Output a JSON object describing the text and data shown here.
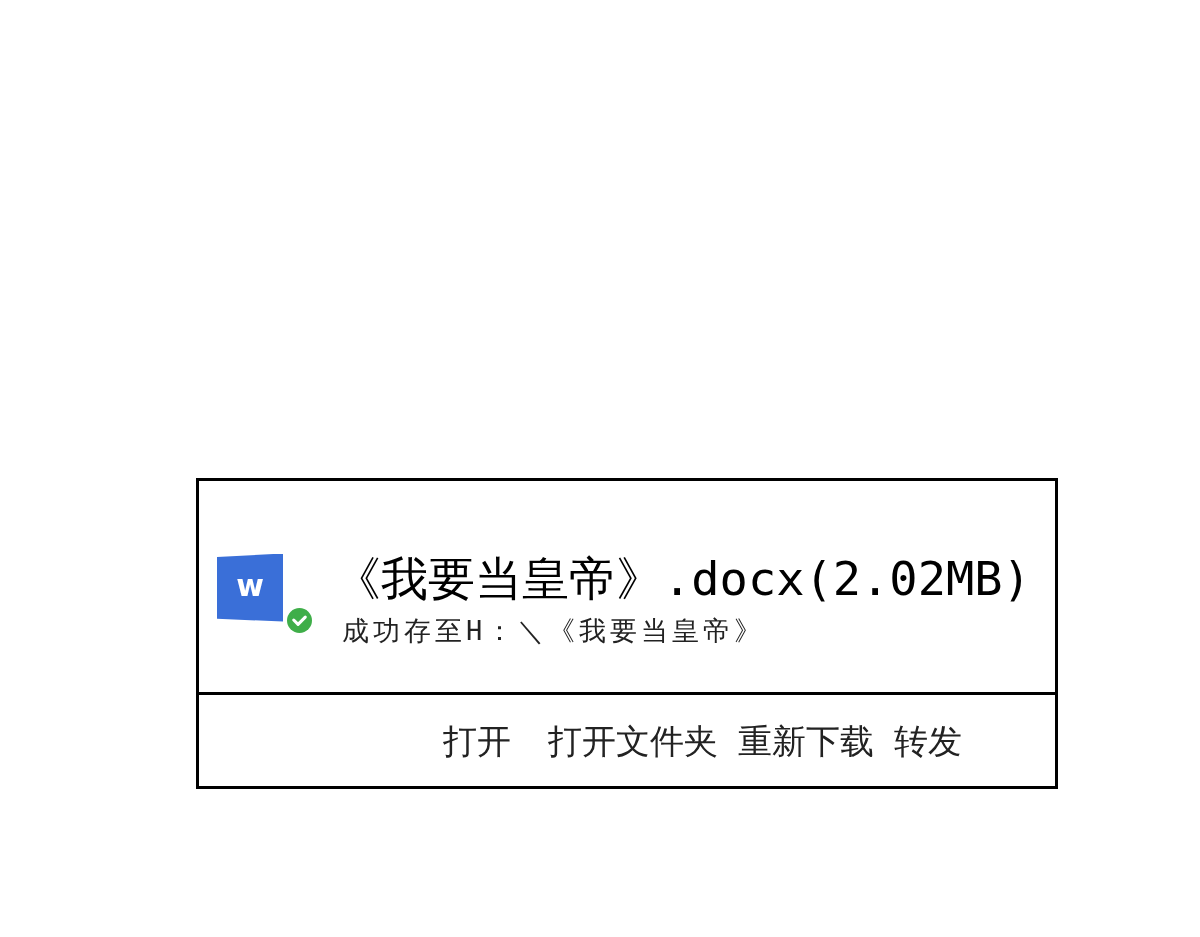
{
  "file_card": {
    "logo_letter": "w",
    "saved": true,
    "file_name": "《我要当皇帝》.docx(2.02MB)",
    "status": "成功存至H：＼《我要当皇帝》",
    "actions": [
      "打开",
      "打开文件夹",
      "重新下载",
      "转发"
    ]
  }
}
